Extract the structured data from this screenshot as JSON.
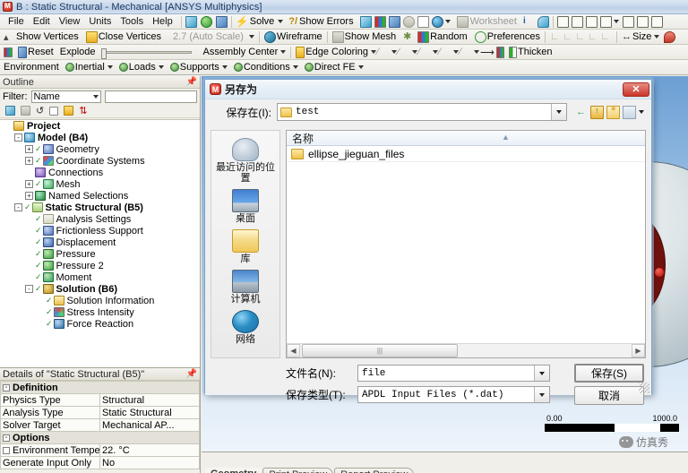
{
  "window": {
    "title": "B : Static Structural - Mechanical [ANSYS Multiphysics]",
    "icon": "ansys-mechanical-icon"
  },
  "menubar": {
    "items": [
      "File",
      "Edit",
      "View",
      "Units",
      "Tools",
      "Help"
    ],
    "solve_label": "Solve",
    "show_errors_label": "Show Errors",
    "worksheet_label": "Worksheet"
  },
  "toolbar2": {
    "show_vertices": "Show Vertices",
    "close_vertices": "Close Vertices",
    "auto_scale": "2.7 (Auto Scale)",
    "wireframe": "Wireframe",
    "show_mesh": "Show Mesh",
    "random": "Random",
    "preferences": "Preferences",
    "size": "Size"
  },
  "toolbar3": {
    "reset": "Reset",
    "explode": "Explode",
    "assembly_center": "Assembly Center",
    "edge_coloring": "Edge Coloring",
    "thicken": "Thicken"
  },
  "toolbar4": {
    "environment": "Environment",
    "inertial": "Inertial",
    "loads": "Loads",
    "supports": "Supports",
    "conditions": "Conditions",
    "direct_fe": "Direct FE"
  },
  "outline": {
    "header": "Outline",
    "filter_label": "Filter:",
    "filter_value": "Name",
    "filter_text": "",
    "tree": [
      {
        "label": "Project",
        "indent": 0,
        "expander": "",
        "icon": "project-icon",
        "check": false,
        "bold": true
      },
      {
        "label": "Model (B4)",
        "indent": 1,
        "expander": "-",
        "icon": "model-icon",
        "check": false,
        "bold": true
      },
      {
        "label": "Geometry",
        "indent": 2,
        "expander": "+",
        "icon": "geometry-icon",
        "check": true,
        "bold": false
      },
      {
        "label": "Coordinate Systems",
        "indent": 2,
        "expander": "+",
        "icon": "coordinate-systems-icon",
        "check": true,
        "bold": false
      },
      {
        "label": "Connections",
        "indent": 2,
        "expander": "",
        "icon": "connections-icon",
        "check": false,
        "bold": false
      },
      {
        "label": "Mesh",
        "indent": 2,
        "expander": "+",
        "icon": "mesh-icon",
        "check": true,
        "bold": false
      },
      {
        "label": "Named Selections",
        "indent": 2,
        "expander": "+",
        "icon": "named-selections-icon",
        "check": false,
        "bold": false
      },
      {
        "label": "Static Structural (B5)",
        "indent": 1,
        "expander": "-",
        "icon": "static-structural-icon",
        "check": true,
        "bold": true
      },
      {
        "label": "Analysis Settings",
        "indent": 2,
        "expander": "",
        "icon": "analysis-settings-icon",
        "check": true,
        "bold": false
      },
      {
        "label": "Frictionless Support",
        "indent": 2,
        "expander": "",
        "icon": "frictionless-support-icon",
        "check": true,
        "bold": false
      },
      {
        "label": "Displacement",
        "indent": 2,
        "expander": "",
        "icon": "displacement-icon",
        "check": true,
        "bold": false
      },
      {
        "label": "Pressure",
        "indent": 2,
        "expander": "",
        "icon": "pressure-icon",
        "check": true,
        "bold": false
      },
      {
        "label": "Pressure 2",
        "indent": 2,
        "expander": "",
        "icon": "pressure-icon",
        "check": true,
        "bold": false
      },
      {
        "label": "Moment",
        "indent": 2,
        "expander": "",
        "icon": "moment-icon",
        "check": true,
        "bold": false
      },
      {
        "label": "Solution (B6)",
        "indent": 2,
        "expander": "-",
        "icon": "solution-icon",
        "check": true,
        "bold": true
      },
      {
        "label": "Solution Information",
        "indent": 3,
        "expander": "",
        "icon": "solution-information-icon",
        "check": true,
        "bold": false
      },
      {
        "label": "Stress Intensity",
        "indent": 3,
        "expander": "",
        "icon": "stress-intensity-icon",
        "check": true,
        "bold": false
      },
      {
        "label": "Force Reaction",
        "indent": 3,
        "expander": "",
        "icon": "force-reaction-icon",
        "check": true,
        "bold": false
      }
    ]
  },
  "details": {
    "header": "Details of \"Static Structural (B5)\"",
    "rows": [
      {
        "type": "group",
        "key": "Definition",
        "value": ""
      },
      {
        "type": "row",
        "key": "Physics Type",
        "value": "Structural"
      },
      {
        "type": "row",
        "key": "Analysis Type",
        "value": "Static Structural"
      },
      {
        "type": "row",
        "key": "Solver Target",
        "value": "Mechanical AP..."
      },
      {
        "type": "group",
        "key": "Options",
        "value": ""
      },
      {
        "type": "check",
        "key": "Environment Temperature",
        "value": "22. °C"
      },
      {
        "type": "row",
        "key": "Generate Input Only",
        "value": "No"
      }
    ]
  },
  "dialog": {
    "title": "另存为",
    "close_label": "✕",
    "save_in_label": "保存在(I):",
    "save_in_value": "test",
    "places": [
      {
        "label": "最近访问的位置",
        "icon": "recent-places-icon"
      },
      {
        "label": "桌面",
        "icon": "desktop-icon"
      },
      {
        "label": "库",
        "icon": "library-icon"
      },
      {
        "label": "计算机",
        "icon": "computer-icon"
      },
      {
        "label": "网络",
        "icon": "network-icon"
      }
    ],
    "file_list": {
      "column_name": "名称",
      "items": [
        {
          "name": "ellipse_jieguan_files",
          "icon": "folder-icon"
        }
      ]
    },
    "filename_label": "文件名(N):",
    "filename_value": "file",
    "filetype_label": "保存类型(T):",
    "filetype_value": "APDL Input Files (*.dat)",
    "save_button": "保存(S)",
    "cancel_button": "取消"
  },
  "viewport": {
    "legend_min": "0.00",
    "legend_max": "1000.0",
    "watermark": "仿真秀"
  },
  "bottom_tabs": [
    {
      "label": "Geometry",
      "active": true
    },
    {
      "label": "Print Preview",
      "active": false
    },
    {
      "label": "Report Preview",
      "active": false
    }
  ]
}
